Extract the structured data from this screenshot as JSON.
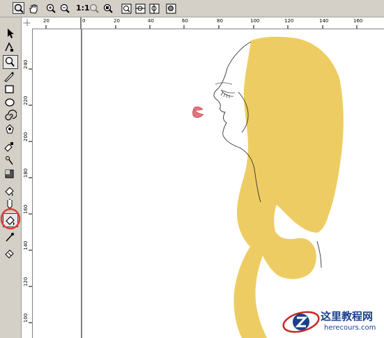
{
  "zoom_toolbar": {
    "one_to_one_label": "1:1"
  },
  "rulers": {
    "horizontal_labels": [
      "20",
      "0",
      "20",
      "40",
      "60",
      "80",
      "100",
      "120",
      "140",
      "160"
    ],
    "vertical_labels": [
      "240",
      "220",
      "200",
      "180",
      "160",
      "140",
      "120",
      "100"
    ]
  },
  "watermark": {
    "site_name": "这里教程网",
    "url": "herecours.com"
  },
  "colors": {
    "hair": "#edcd63",
    "lips": "#e8707e",
    "highlight_circle": "#e23b3b"
  },
  "tools": [
    "pick-tool",
    "shape-tool",
    "zoom-tool",
    "freehand-tool",
    "rectangle-tool",
    "ellipse-tool",
    "spiral-tool",
    "basic-shapes-tool",
    "text-tool",
    "interactive-blend-tool",
    "eyedropper-tool",
    "outline-tool",
    "fill-tool",
    "interactive-fill-tool",
    "smart-fill-tool",
    "mesh-fill-tool",
    "eyedropper-fill-tool"
  ]
}
